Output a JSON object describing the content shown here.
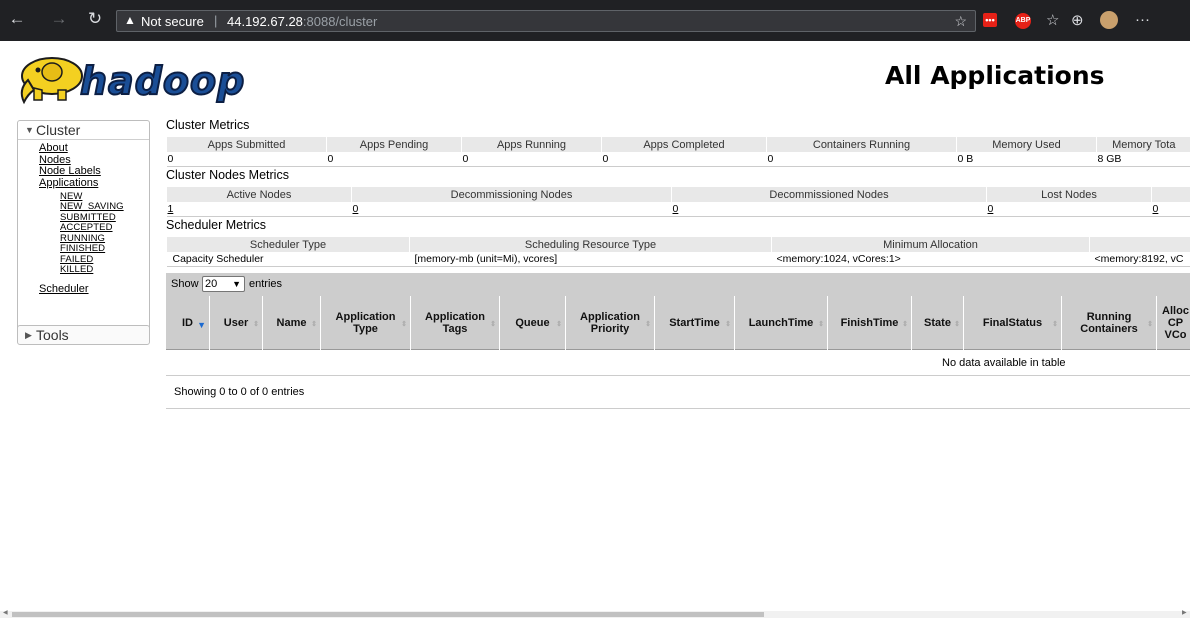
{
  "browser": {
    "back_icon": "←",
    "forward_icon": "→",
    "reload_icon": "↻",
    "warning_icon": "▲",
    "not_secure": "Not secure",
    "separator": "|",
    "host": "44.192.67.28",
    "port_path": ":8088/cluster",
    "ext1_label": "•••",
    "ext2_label": "ABP",
    "more_icon": "···"
  },
  "header": {
    "title": "All Applications",
    "logo_text": "hadoop"
  },
  "sidebar": {
    "cluster_label": "Cluster",
    "links": [
      "About",
      "Nodes",
      "Node Labels",
      "Applications"
    ],
    "app_states": [
      "NEW",
      "NEW_SAVING",
      "SUBMITTED",
      "ACCEPTED",
      "RUNNING",
      "FINISHED",
      "FAILED",
      "KILLED"
    ],
    "scheduler_label": "Scheduler",
    "tools_label": "Tools"
  },
  "cluster_metrics": {
    "title": "Cluster Metrics",
    "headers": [
      "Apps Submitted",
      "Apps Pending",
      "Apps Running",
      "Apps Completed",
      "Containers Running",
      "Memory Used",
      "Memory Tota"
    ],
    "values": [
      "0",
      "0",
      "0",
      "0",
      "0",
      "0 B",
      "8 GB"
    ]
  },
  "node_metrics": {
    "title": "Cluster Nodes Metrics",
    "headers": [
      "Active Nodes",
      "Decommissioning Nodes",
      "Decommissioned Nodes",
      "Lost Nodes",
      ""
    ],
    "values": [
      "1",
      "0",
      "0",
      "0",
      "0"
    ]
  },
  "scheduler_metrics": {
    "title": "Scheduler Metrics",
    "headers": [
      "Scheduler Type",
      "Scheduling Resource Type",
      "Minimum Allocation",
      ""
    ],
    "values": [
      "Capacity Scheduler",
      "[memory-mb (unit=Mi), vcores]",
      "<memory:1024, vCores:1>",
      "<memory:8192, vC"
    ]
  },
  "apps_table": {
    "show_label": "Show",
    "page_length": "20",
    "entries_label": "entries",
    "columns": [
      "ID",
      "User",
      "Name",
      "Application Type",
      "Application Tags",
      "Queue",
      "Application Priority",
      "StartTime",
      "LaunchTime",
      "FinishTime",
      "State",
      "FinalStatus",
      "Running Containers",
      "Alloc CP VCo"
    ],
    "empty_message": "No data available in table",
    "info": "Showing 0 to 0 of 0 entries"
  }
}
